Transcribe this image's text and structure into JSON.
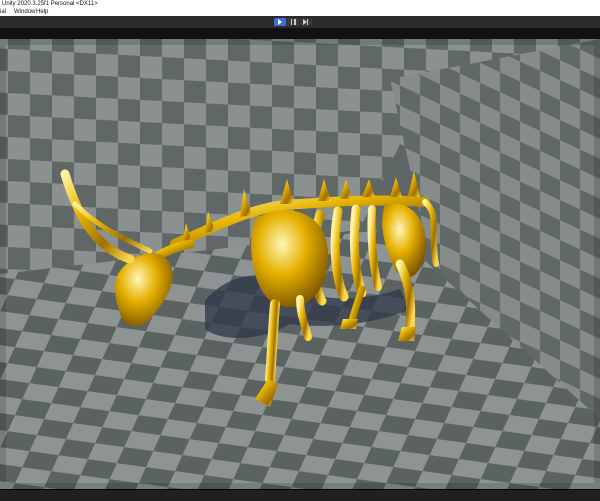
{
  "window": {
    "title": "Unity 2020.3.25f1 Personal <DX11>"
  },
  "menu": {
    "items": [
      "ial",
      "Window",
      "Help"
    ]
  },
  "toolbar": {
    "play": "play-icon",
    "pause": "pause-icon",
    "step": "step-icon"
  },
  "colors": {
    "accent": "#3b6fd6",
    "gold": "#d9a300",
    "checker_light": "#8a9190",
    "checker_dark": "#606867"
  }
}
